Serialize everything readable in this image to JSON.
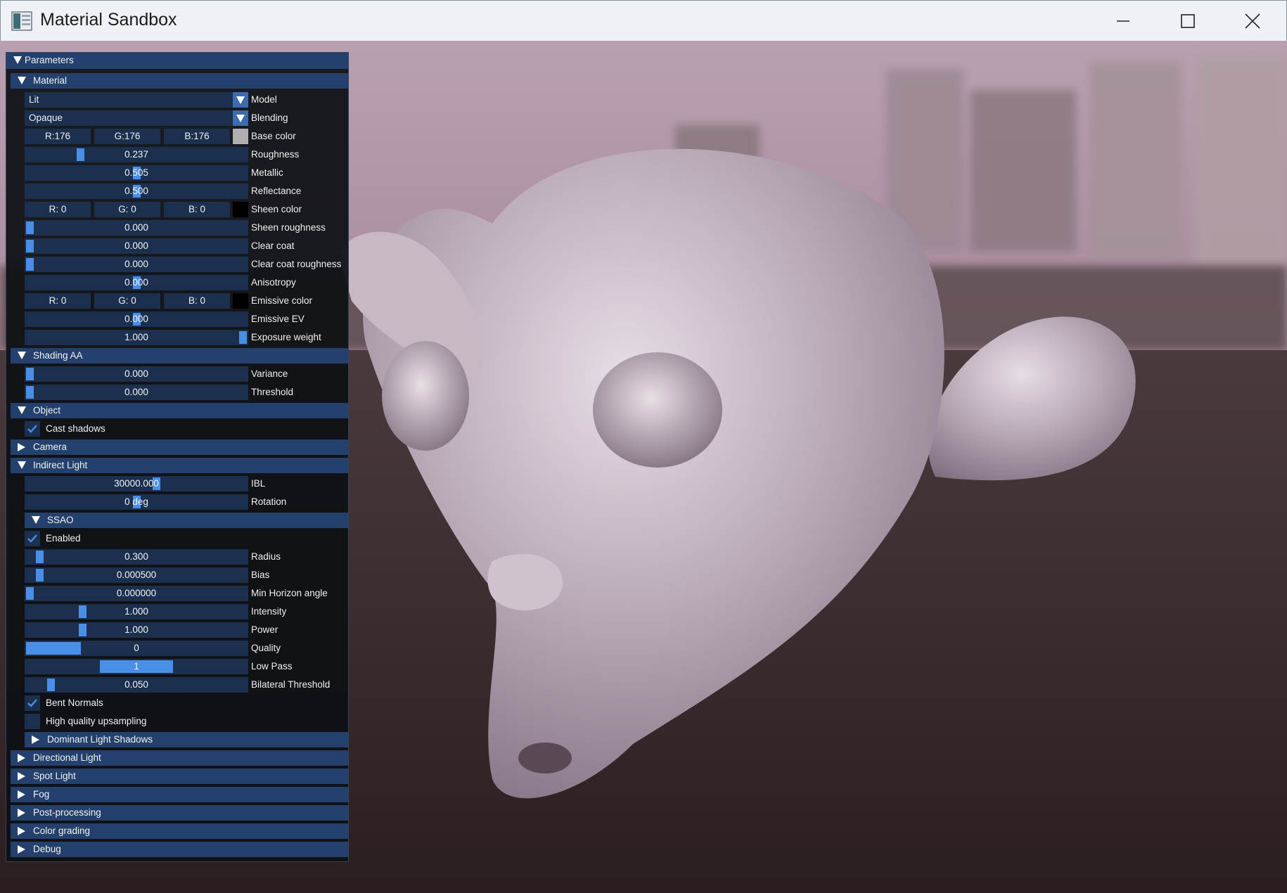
{
  "window": {
    "title": "Material Sandbox",
    "minimize_icon": "minimize-icon",
    "maximize_icon": "maximize-icon",
    "close_icon": "close-icon"
  },
  "panel": {
    "parameters": "Parameters",
    "material": {
      "header": "Material",
      "model": {
        "value": "Lit",
        "label": "Model"
      },
      "blending": {
        "value": "Opaque",
        "label": "Blending"
      },
      "base_color": {
        "r": "R:176",
        "g": "G:176",
        "b": "B:176",
        "label": "Base color",
        "swatch": "#b0b0b0"
      },
      "roughness": {
        "value": "0.237",
        "label": "Roughness",
        "level": 0.237
      },
      "metallic": {
        "value": "0.505",
        "label": "Metallic",
        "level": 0.505
      },
      "reflectance": {
        "value": "0.500",
        "label": "Reflectance",
        "level": 0.5
      },
      "sheen_color": {
        "r": "R:  0",
        "g": "G:  0",
        "b": "B:  0",
        "label": "Sheen color",
        "swatch": "#000000"
      },
      "sheen_roughness": {
        "value": "0.000",
        "label": "Sheen roughness",
        "level": 0
      },
      "clear_coat": {
        "value": "0.000",
        "label": "Clear coat",
        "level": 0
      },
      "clear_coat_roughness": {
        "value": "0.000",
        "label": "Clear coat roughness",
        "level": 0
      },
      "anisotropy": {
        "value": "0.000",
        "label": "Anisotropy",
        "level": 0.5
      },
      "emissive_color": {
        "r": "R:  0",
        "g": "G:  0",
        "b": "B:  0",
        "label": "Emissive color",
        "swatch": "#000000"
      },
      "emissive_ev": {
        "value": "0.000",
        "label": "Emissive EV",
        "level": 0.5
      },
      "exposure_weight": {
        "value": "1.000",
        "label": "Exposure weight",
        "level": 1.0
      }
    },
    "shading_aa": {
      "header": "Shading AA",
      "variance": {
        "value": "0.000",
        "label": "Variance",
        "level": 0
      },
      "threshold": {
        "value": "0.000",
        "label": "Threshold",
        "level": 0
      }
    },
    "object": {
      "header": "Object",
      "cast_shadows": {
        "label": "Cast shadows",
        "checked": true
      }
    },
    "camera": {
      "header": "Camera"
    },
    "indirect_light": {
      "header": "Indirect Light",
      "ibl": {
        "value": "30000.000",
        "label": "IBL",
        "level": 0.6
      },
      "rotation": {
        "value": "0 deg",
        "label": "Rotation",
        "level": 0.5
      },
      "ssao": {
        "header": "SSAO",
        "enabled": {
          "label": "Enabled",
          "checked": true
        },
        "radius": {
          "value": "0.300",
          "label": "Radius",
          "level": 0.06
        },
        "bias": {
          "value": "0.000500",
          "label": "Bias",
          "level": 0.06
        },
        "min_horizon_angle": {
          "value": "0.000000",
          "label": "Min Horizon angle",
          "level": 0
        },
        "intensity": {
          "value": "1.000",
          "label": "Intensity",
          "level": 0.25
        },
        "power": {
          "value": "1.000",
          "label": "Power",
          "level": 0.25
        },
        "quality": {
          "value": "0",
          "label": "Quality",
          "level": 0.25
        },
        "low_pass": {
          "value": "1",
          "label": "Low Pass",
          "level": 0.5
        },
        "bilateral_threshold": {
          "value": "0.050",
          "label": "Bilateral Threshold",
          "level": 0.1
        },
        "bent_normals": {
          "label": "Bent Normals",
          "checked": true
        },
        "high_quality_upsampling": {
          "label": "High quality upsampling",
          "checked": false
        },
        "dominant_light_shadows": {
          "header": "Dominant Light Shadows"
        }
      }
    },
    "directional_light": {
      "header": "Directional Light"
    },
    "spot_light": {
      "header": "Spot Light"
    },
    "fog": {
      "header": "Fog"
    },
    "post_processing": {
      "header": "Post-processing"
    },
    "color_grading": {
      "header": "Color grading"
    },
    "debug": {
      "header": "Debug"
    }
  },
  "colors": {
    "header_bg": "#24406c",
    "frame_bg": "#1b2f4f",
    "accent": "#4a8fe7"
  }
}
